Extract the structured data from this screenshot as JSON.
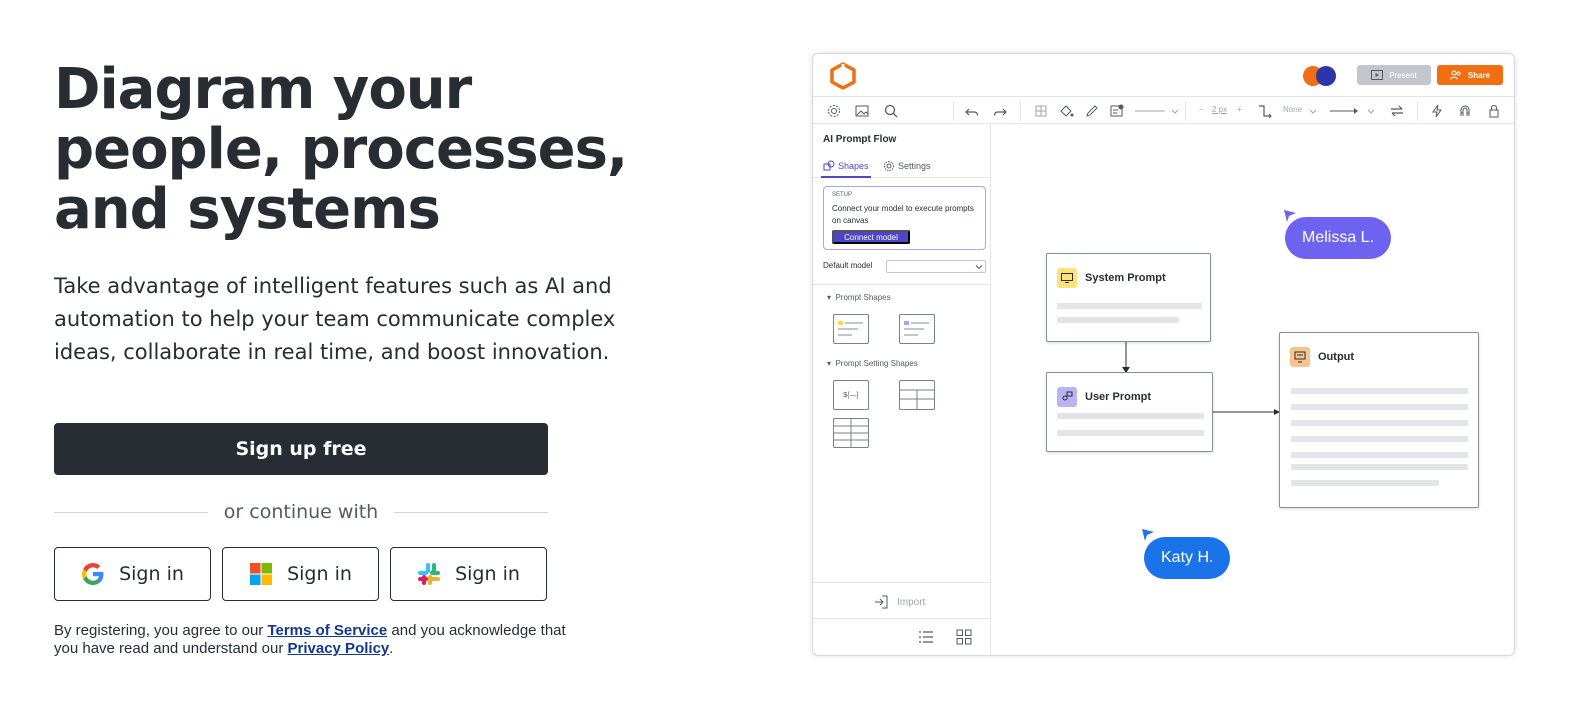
{
  "hero": {
    "headline": "Diagram your people, processes, and systems",
    "subtext": "Take advantage of intelligent features such as AI and automation to help your team communicate complex ideas, collaborate in real time, and boost innovation.",
    "signup_label": "Sign up free",
    "divider_text": "or continue with",
    "sso": [
      {
        "provider_icon": "google-icon",
        "label": "Sign in"
      },
      {
        "provider_icon": "microsoft-icon",
        "label": "Sign in"
      },
      {
        "provider_icon": "slack-icon",
        "label": "Sign in"
      }
    ],
    "legal": {
      "prefix": "By registering, you agree to our ",
      "terms_link": "Terms of Service",
      "middle": " and you acknowledge that you have read and understand our ",
      "privacy_link": "Privacy Policy",
      "suffix": "."
    }
  },
  "app": {
    "header": {
      "present_label": "Present",
      "share_label": "Share"
    },
    "toolbar": {
      "line_width": "2 px",
      "line_end": "None"
    },
    "sidebar": {
      "doc_title": "AI Prompt Flow",
      "tabs": [
        {
          "label": "Shapes",
          "active": true
        },
        {
          "label": "Settings",
          "active": false
        }
      ],
      "setup": {
        "label": "SETUP",
        "text": "Connect your model to execute prompts on canvas",
        "button": "Connect model"
      },
      "default_model_label": "Default model",
      "sections": [
        "Prompt Shapes",
        "Prompt Setting Shapes"
      ],
      "variable_tile_text": "${—}",
      "import_label": "Import"
    },
    "canvas": {
      "nodes": [
        {
          "title": "System Prompt"
        },
        {
          "title": "User Prompt"
        },
        {
          "title": "Output"
        }
      ],
      "collaborators": [
        {
          "name": "Melissa L.",
          "color": "#6e63f0"
        },
        {
          "name": "Katy H.",
          "color": "#1a73e8"
        }
      ]
    }
  },
  "colors": {
    "dark": "#282c33",
    "accent": "#4b47c4",
    "share_orange": "#f06f13",
    "link": "#14398a"
  }
}
